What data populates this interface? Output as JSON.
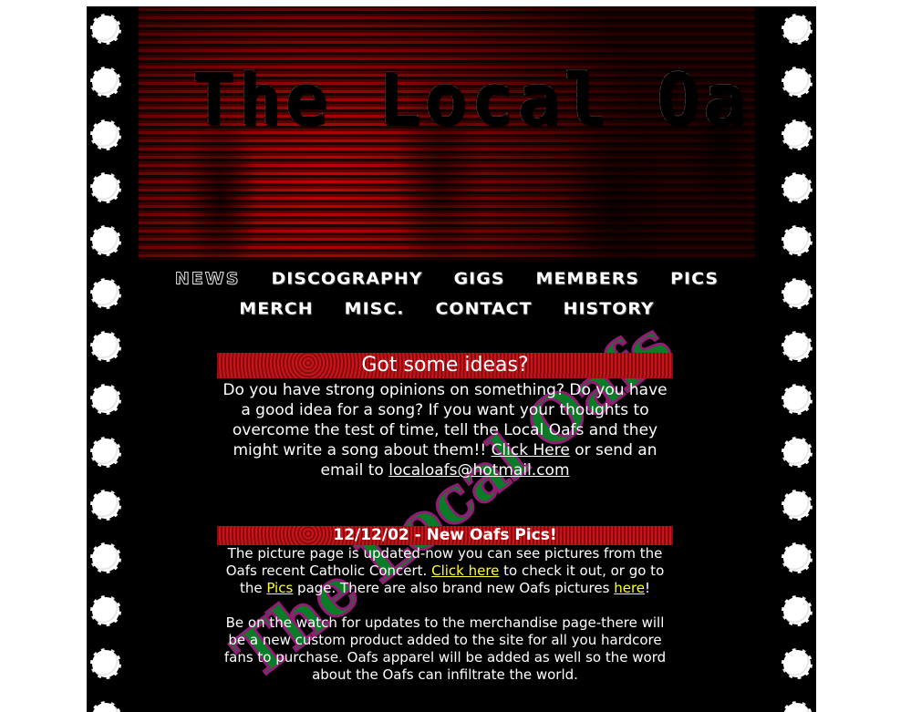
{
  "site": {
    "logo_text": "The Local Oafs",
    "watermark_text": "The Local Oafs"
  },
  "nav": {
    "row1": [
      {
        "label": "NEWS",
        "active": true
      },
      {
        "label": "DISCOGRAPHY"
      },
      {
        "label": "GIGS"
      },
      {
        "label": "MEMBERS"
      },
      {
        "label": "PICS"
      }
    ],
    "row2": [
      {
        "label": "MERCH"
      },
      {
        "label": "MISC."
      },
      {
        "label": "CONTACT"
      },
      {
        "label": "HISTORY"
      }
    ]
  },
  "ideas": {
    "title": "Got some ideas?",
    "text_before": "Do you have strong opinions on something? Do you have a good idea for a song? If you want your thoughts to overcome the test of time, tell the Local Oafs and they might write a song about them!! ",
    "link_click_here": "Click Here",
    "text_middle": " or send an email to ",
    "email": "localoafs@hotmail.com"
  },
  "news": {
    "title": "12/12/02 - New Oafs Pics!",
    "p1_a": "The picture page is updated-now you can see pictures from the Oafs recent Catholic Concert. ",
    "p1_link1": "Click here",
    "p1_b": " to check it out, or go to the ",
    "p1_link2": "Pics",
    "p1_c": " page. There are also brand new Oafs pictures ",
    "p1_link3": "here",
    "p1_d": "!",
    "p2": "Be on the watch for updates to the merchandise page-there will be a new custom product added to the site for all you hardcore fans to purchase. Oafs apparel will be added as well so the word about the Oafs can infiltrate the world."
  },
  "colors": {
    "background": "#000000",
    "header_bar_red": "#b1121a",
    "link_yellow": "#ffff33",
    "watermark_green": "#0c8a2c",
    "watermark_outline": "#a02080"
  }
}
